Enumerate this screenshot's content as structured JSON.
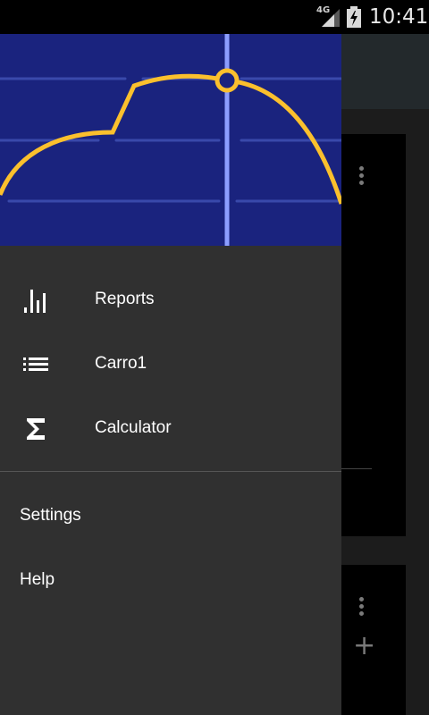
{
  "status_bar": {
    "network": "4G",
    "time": "10:41"
  },
  "drawer": {
    "primary_items": [
      {
        "label": "Reports",
        "icon": "bar-chart-icon"
      },
      {
        "label": "Carro1",
        "icon": "list-icon"
      },
      {
        "label": "Calculator",
        "icon": "sigma-icon"
      }
    ],
    "secondary_items": [
      {
        "label": "Settings"
      },
      {
        "label": "Help"
      }
    ]
  },
  "colors": {
    "header_bg": "#1a237e",
    "curve": "#fbc02d",
    "indicator": "#8c9eff",
    "drawer_bg": "#303030"
  }
}
